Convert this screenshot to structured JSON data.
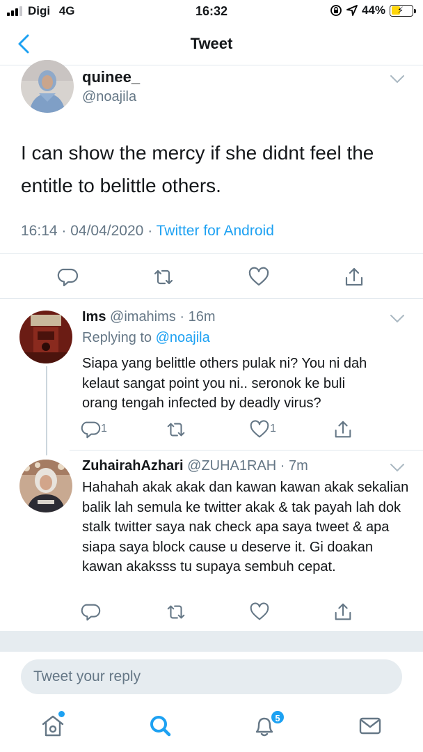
{
  "status_bar": {
    "carrier": "Digi",
    "network": "4G",
    "time": "16:32",
    "battery": "44%",
    "battery_color": "#ffd60a"
  },
  "nav": {
    "title": "Tweet",
    "back_icon": "chevron-left-icon"
  },
  "main_tweet": {
    "name": "quinee_",
    "handle": "@noajila",
    "text": "I can show the mercy if she didnt feel the entitle to belittle others.",
    "time": "16:14",
    "date": "04/04/2020",
    "source": "Twitter for Android",
    "actions": [
      "reply-icon",
      "retweet-icon",
      "like-icon",
      "share-icon"
    ]
  },
  "replies": [
    {
      "name": "Ims",
      "handle": "@imahims",
      "age": "16m",
      "replying_prefix": "Replying to",
      "replying_to": "@noajila",
      "text": "Siapa yang belittle others pulak ni? You ni dah kelaut sangat point you ni.. seronok ke buli orang tengah infected by deadly virus?",
      "reply_count": "1",
      "like_count": "1"
    },
    {
      "name": "ZuhairahAzhari",
      "handle": "@ZUHA1RAH",
      "age": "7m",
      "text": "Hahahah akak akak dan kawan kawan akak sekalian balik lah semula ke twitter akak & tak payah lah dok stalk twitter saya nak check apa saya tweet & apa siapa saya block cause u deserve it. Gi doakan kawan akaksss tu supaya sembuh cepat."
    }
  ],
  "compose": {
    "placeholder": "Tweet your reply"
  },
  "tab_bar": {
    "notifications_badge": "5",
    "accent": "#1da1f2"
  }
}
